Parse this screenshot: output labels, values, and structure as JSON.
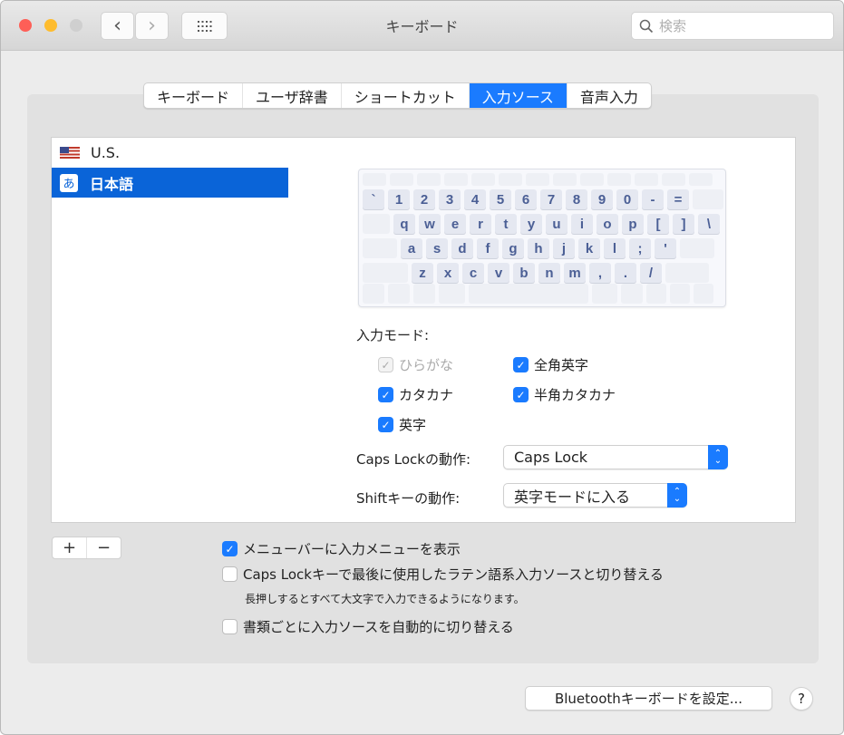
{
  "window": {
    "title": "キーボード",
    "search_placeholder": "検索",
    "traffic_lights": {
      "close": "#fe5f57",
      "minimize": "#febc2e",
      "zoom": "#cfcfcf"
    },
    "nav": {
      "back": "‹",
      "forward": "›",
      "grid": "show-all-icon"
    }
  },
  "tabs": [
    {
      "label": "キーボード",
      "active": false
    },
    {
      "label": "ユーザ辞書",
      "active": false
    },
    {
      "label": "ショートカット",
      "active": false
    },
    {
      "label": "入力ソース",
      "active": true
    },
    {
      "label": "音声入力",
      "active": false
    }
  ],
  "sources": [
    {
      "label": "U.S.",
      "icon": "us-flag-icon",
      "selected": false
    },
    {
      "label": "日本語",
      "icon_glyph": "あ",
      "icon": "hiragana-icon",
      "selected": true
    }
  ],
  "keyboard": {
    "rows": [
      [
        "`",
        "1",
        "2",
        "3",
        "4",
        "5",
        "6",
        "7",
        "8",
        "9",
        "0",
        "-",
        "="
      ],
      [
        "q",
        "w",
        "e",
        "r",
        "t",
        "y",
        "u",
        "i",
        "o",
        "p",
        "[",
        "]",
        "\\"
      ],
      [
        "a",
        "s",
        "d",
        "f",
        "g",
        "h",
        "j",
        "k",
        "l",
        ";",
        "'"
      ],
      [
        "z",
        "x",
        "c",
        "v",
        "b",
        "n",
        "m",
        ",",
        ".",
        "/"
      ]
    ]
  },
  "input_modes": {
    "label": "入力モード:",
    "items": [
      {
        "label": "ひらがな",
        "checked": true,
        "disabled": true
      },
      {
        "label": "全角英字",
        "checked": true,
        "disabled": false
      },
      {
        "label": "カタカナ",
        "checked": true,
        "disabled": false
      },
      {
        "label": "半角カタカナ",
        "checked": true,
        "disabled": false
      },
      {
        "label": "英字",
        "checked": true,
        "disabled": false
      }
    ]
  },
  "caps_lock": {
    "label": "Caps Lockの動作:",
    "value": "Caps Lock"
  },
  "shift": {
    "label": "Shiftキーの動作:",
    "value": "英字モードに入る"
  },
  "list_buttons": {
    "add": "+",
    "remove": "−"
  },
  "options": [
    {
      "label": "メニューバーに入力メニューを表示",
      "checked": true
    },
    {
      "label": "Caps Lockキーで最後に使用したラテン語系入力ソースと切り替える",
      "checked": false,
      "note": "長押しするとすべて大文字で入力できるようになります。"
    },
    {
      "label": "書類ごとに入力ソースを自動的に切り替える",
      "checked": false
    }
  ],
  "footer": {
    "bluetooth_button": "Bluetoothキーボードを設定...",
    "help": "?"
  },
  "check_glyph": "✓"
}
